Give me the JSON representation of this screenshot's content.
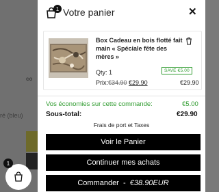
{
  "background": {
    "snippet_1": "co",
    "snippet_2": "ré (bleu)",
    "cart_count": "1"
  },
  "cart": {
    "count": "1",
    "title": "Votre panier",
    "close": "✕"
  },
  "item": {
    "name": "Box Cadeau en bois flotté fait main « Spéciale fête des mères »",
    "qty": "Qty: 1",
    "save_badge": "SAVE €5.00",
    "price_label": "Prix:",
    "old_price": "€34.90",
    "new_price": "€29.90",
    "line_total": "€29.90"
  },
  "summary": {
    "savings_label": "Vos économies sur cette commande:",
    "savings_value": "€5.00",
    "subtotal_label": "Sous-total:",
    "subtotal_value": "€29.90",
    "shipping_note": "Frais de port et Taxes"
  },
  "buttons": {
    "view_cart": "Voir le Panier",
    "continue": "Continuer mes achats",
    "checkout_label": "Commander",
    "checkout_sep": "-",
    "checkout_price": "€38.90EUR"
  },
  "colors": {
    "accent_green": "#2e9b2e",
    "button_bg": "#000000"
  },
  "icons": {
    "cart": "shopping-bag-icon",
    "close": "close-icon",
    "trash": "trash-icon"
  }
}
